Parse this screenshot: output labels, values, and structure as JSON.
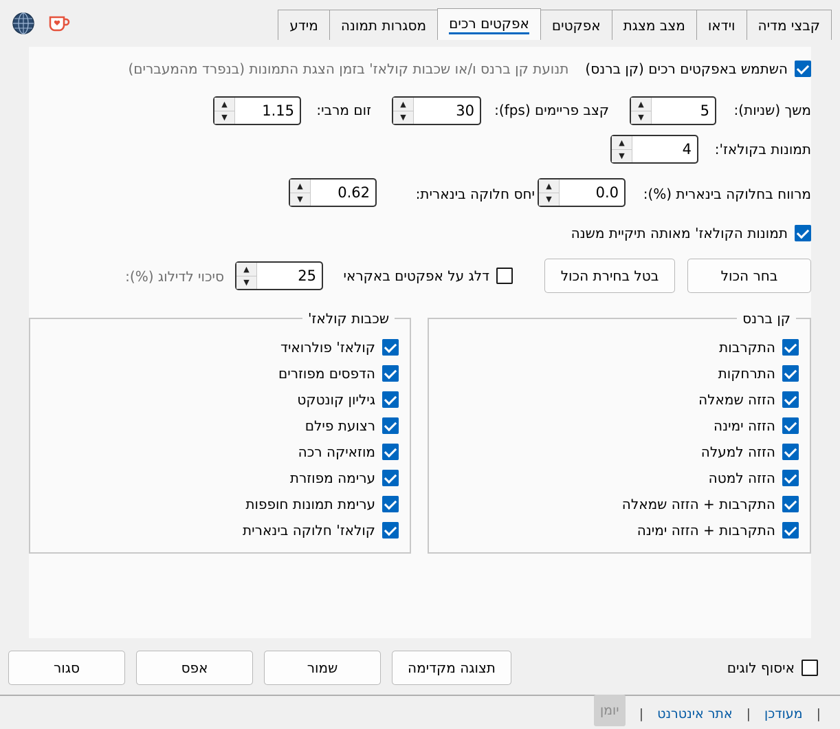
{
  "tabs": [
    {
      "label": "קבצי מדיה"
    },
    {
      "label": "וידאו"
    },
    {
      "label": "מצב מצגת"
    },
    {
      "label": "אפקטים"
    },
    {
      "label": "אפקטים רכים"
    },
    {
      "label": "מסגרות תמונה"
    },
    {
      "label": "מידע"
    }
  ],
  "active_tab": "אפקטים רכים",
  "soft": {
    "enable_label": "השתמש באפקטים רכים (קן ברנס)",
    "enable_desc": "תנועת קן ברנס ו/או שכבות קולאז' בזמן הצגת התמונות (בנפרד מהמעברים)",
    "enable_checked": true,
    "duration_label": "משך (שניות):",
    "duration_value": "5",
    "fps_label": "קצב פריימים (fps):",
    "fps_value": "30",
    "zoom_label": "זום מרבי:",
    "zoom_value": "1.15",
    "collage_images_label": "תמונות בקולאז':",
    "collage_images_value": "4",
    "gap_label": "מרווח בחלוקה בינארית (%):",
    "gap_value": "0.0",
    "ratio_label": "יחס חלוקה בינארית:",
    "ratio_value": "0.62",
    "same_folder_label": "תמונות הקולאז' מאותה תיקיית משנה",
    "same_folder_checked": true,
    "select_all": "בחר הכול",
    "deselect_all": "בטל בחירת הכול",
    "random_skip_label": "דלג על אפקטים באקראי",
    "random_skip_checked": false,
    "skip_chance_value": "25",
    "skip_chance_label": "סיכוי לדילוג (%):"
  },
  "kenburns": {
    "title": "קן ברנס",
    "items": [
      {
        "label": "התקרבות",
        "checked": true
      },
      {
        "label": "התרחקות",
        "checked": true
      },
      {
        "label": "הזזה שמאלה",
        "checked": true
      },
      {
        "label": "הזזה ימינה",
        "checked": true
      },
      {
        "label": "הזזה למעלה",
        "checked": true
      },
      {
        "label": "הזזה למטה",
        "checked": true
      },
      {
        "label": "התקרבות + הזזה שמאלה",
        "checked": true
      },
      {
        "label": "התקרבות + הזזה ימינה",
        "checked": true
      }
    ]
  },
  "collage": {
    "title": "שכבות קולאז'",
    "items": [
      {
        "label": "קולאז' פולרואיד",
        "checked": true
      },
      {
        "label": "הדפסים מפוזרים",
        "checked": true
      },
      {
        "label": "גיליון קונטקט",
        "checked": true
      },
      {
        "label": "רצועת פילם",
        "checked": true
      },
      {
        "label": "מוזאיקה רכה",
        "checked": true
      },
      {
        "label": "ערימה מפוזרת",
        "checked": true
      },
      {
        "label": "ערימת תמונות חופפות",
        "checked": true
      },
      {
        "label": "קולאז' חלוקה בינארית",
        "checked": true
      }
    ]
  },
  "bottom": {
    "collect_logs": "איסוף לוגים",
    "collect_logs_checked": false,
    "preview": "תצוגה מקדימה",
    "save": "שמור",
    "reset": "אפס",
    "close": "סגור"
  },
  "footer": {
    "updated": "מעודכן",
    "website": "אתר אינטרנט",
    "log": "יומן"
  },
  "icons": {
    "globe": "globe-icon",
    "kofi": "kofi-cup-icon"
  }
}
